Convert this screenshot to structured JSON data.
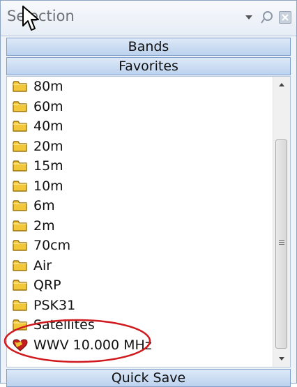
{
  "panel": {
    "title": "Selection"
  },
  "groups": {
    "bands": "Bands",
    "favorites": "Favorites",
    "quick_save": "Quick Save"
  },
  "favorites": {
    "items": [
      {
        "label": "80m",
        "icon": "folder-icon"
      },
      {
        "label": "60m",
        "icon": "folder-icon"
      },
      {
        "label": "40m",
        "icon": "folder-icon"
      },
      {
        "label": "20m",
        "icon": "folder-icon"
      },
      {
        "label": "15m",
        "icon": "folder-icon"
      },
      {
        "label": "10m",
        "icon": "folder-icon"
      },
      {
        "label": "6m",
        "icon": "folder-icon"
      },
      {
        "label": "2m",
        "icon": "folder-icon"
      },
      {
        "label": "70cm",
        "icon": "folder-icon"
      },
      {
        "label": "Air",
        "icon": "folder-icon"
      },
      {
        "label": "QRP",
        "icon": "folder-icon"
      },
      {
        "label": "PSK31",
        "icon": "folder-icon"
      },
      {
        "label": "Satellites",
        "icon": "folder-icon"
      },
      {
        "label": "WWV 10.000 MHz",
        "icon": "favorite-heart-icon"
      }
    ]
  },
  "colors": {
    "folder": "#f3c73a",
    "highlight_ellipse": "#d0191c",
    "header": "#bcd2ee"
  }
}
